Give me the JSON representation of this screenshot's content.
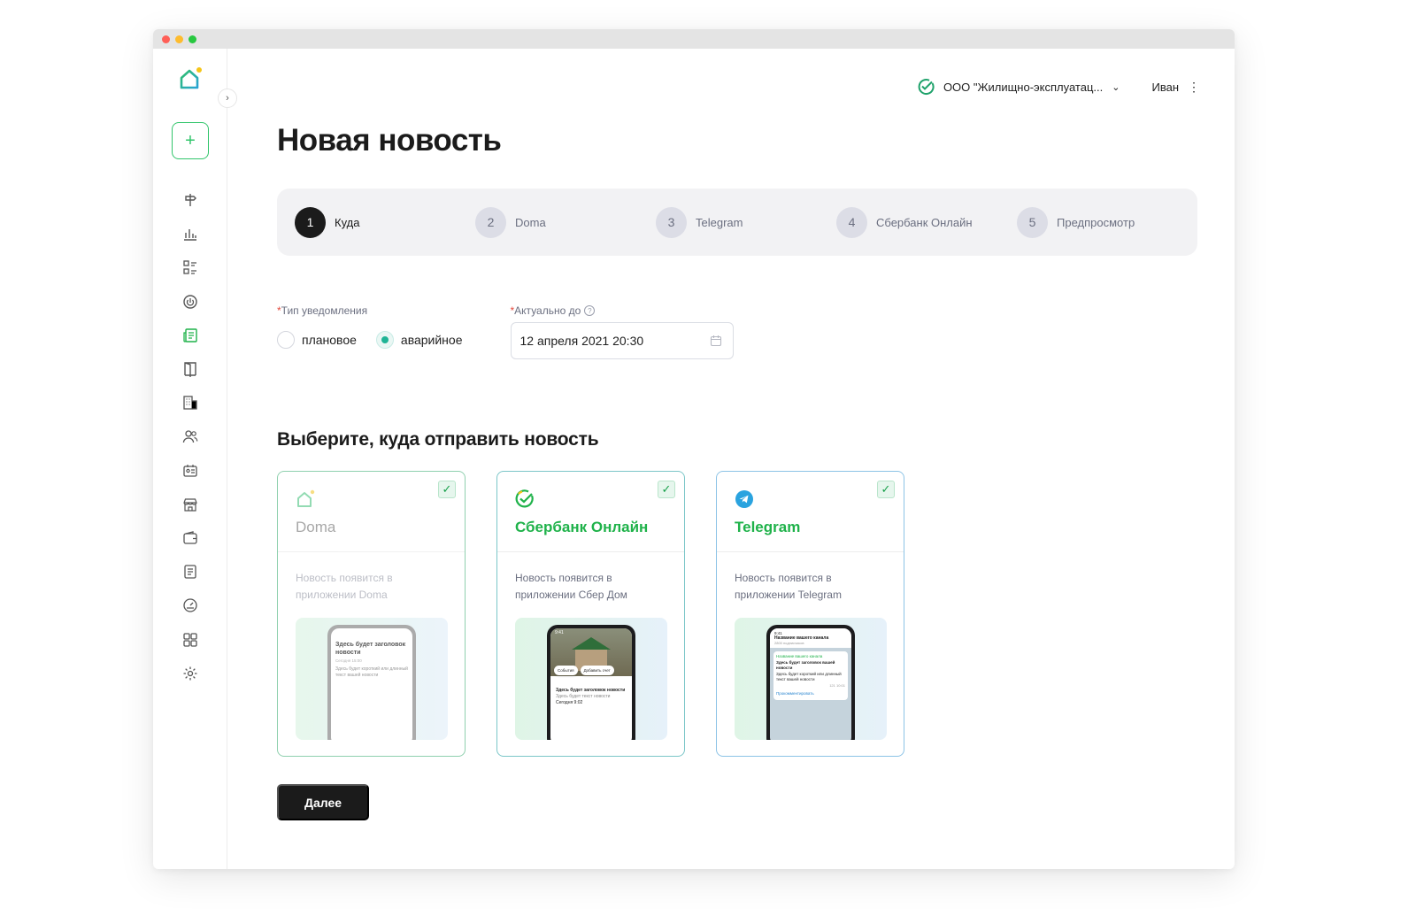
{
  "header": {
    "org_name": "ООО \"Жилищно-эксплуатац...",
    "user_name": "Иван"
  },
  "page": {
    "title": "Новая новость"
  },
  "steps": [
    {
      "num": "1",
      "label": "Куда",
      "active": true
    },
    {
      "num": "2",
      "label": "Doma",
      "active": false
    },
    {
      "num": "3",
      "label": "Telegram",
      "active": false
    },
    {
      "num": "4",
      "label": "Сбербанк Онлайн",
      "active": false
    },
    {
      "num": "5",
      "label": "Предпросмотр",
      "active": false
    }
  ],
  "form": {
    "type_label": "Тип уведомления",
    "type_options": [
      {
        "label": "плановое",
        "checked": false
      },
      {
        "label": "аварийное",
        "checked": true
      }
    ],
    "date_label": "Актуально до",
    "date_value": "12 апреля 2021 20:30",
    "required_mark": "*"
  },
  "section": {
    "title": "Выберите, куда отправить новость"
  },
  "channels": [
    {
      "id": "doma",
      "name": "Doma",
      "description": "Новость появится в приложении Doma",
      "checked": true,
      "preview": {
        "title": "Здесь будет заголовок новости",
        "date": "Сегодня 15:00",
        "text": "Здесь будет короткий или длинный текст вашей новости"
      }
    },
    {
      "id": "sber",
      "name": "Сбербанк Онлайн",
      "description": "Новость появится в приложении Сбер Дом",
      "checked": true,
      "preview": {
        "time": "9:41",
        "pill_events": "События",
        "pill_add": "Добавить счет",
        "title": "Здесь будет заголовок новости",
        "text": "Здесь будет текст новости",
        "date": "Сегодня 9:02"
      }
    },
    {
      "id": "tg",
      "name": "Telegram",
      "description": "Новость появится в приложении Telegram",
      "checked": true,
      "preview": {
        "time": "9:41",
        "channel": "Название вашего канала",
        "subscribers": "2800 подписчиков",
        "channel_tag": "Название вашего канала",
        "title": "Здесь будет заголовок вашей новости",
        "text": "Здесь будет короткий или длинный текст вашей новости",
        "views": "121  10:01",
        "link": "Прокомментировать"
      }
    }
  ],
  "actions": {
    "next_label": "Далее"
  },
  "colors": {
    "accent_green": "#31c56b",
    "brand_sber": "#1fb24a",
    "telegram_blue": "#2aa3df",
    "dark": "#1b1b1b"
  },
  "icons": {
    "nav": [
      "signpost-icon",
      "bar-chart-icon",
      "checklist-icon",
      "power-icon",
      "news-icon",
      "door-icon",
      "building-icon",
      "users-icon",
      "id-card-icon",
      "shop-icon",
      "wallet-icon",
      "document-icon",
      "dashboard-icon",
      "apps-icon",
      "settings-icon"
    ]
  }
}
